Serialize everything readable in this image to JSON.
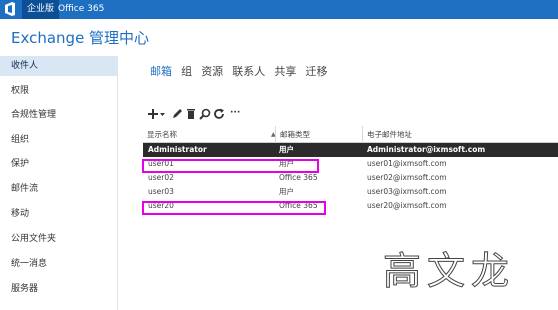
{
  "top_bar": {
    "tab_enterprise": "企业版",
    "tab_office365": "Office 365"
  },
  "app_title": "Exchange 管理中心",
  "sidebar": {
    "items": [
      {
        "label": "收件人",
        "active": true
      },
      {
        "label": "权限"
      },
      {
        "label": "合规性管理"
      },
      {
        "label": "组织"
      },
      {
        "label": "保护"
      },
      {
        "label": "邮件流"
      },
      {
        "label": "移动"
      },
      {
        "label": "公用文件夹"
      },
      {
        "label": "统一消息"
      },
      {
        "label": "服务器"
      }
    ]
  },
  "subnav": {
    "tabs": [
      {
        "label": "邮箱",
        "active": true
      },
      {
        "label": "组"
      },
      {
        "label": "资源"
      },
      {
        "label": "联系人"
      },
      {
        "label": "共享"
      },
      {
        "label": "迁移"
      }
    ]
  },
  "toolbar": {
    "icons": [
      "add-icon",
      "edit-icon",
      "delete-icon",
      "search-icon",
      "refresh-icon",
      "more-icon"
    ],
    "more_label": "···"
  },
  "grid": {
    "columns": [
      "显示名称",
      "邮箱类型",
      "电子邮件地址"
    ],
    "sort_indicator": "▲",
    "rows": [
      {
        "name": "Administrator",
        "type": "用户",
        "email": "Administrator@ixmsoft.com",
        "selected": true
      },
      {
        "name": "user01",
        "type": "用户",
        "email": "user01@ixmsoft.com"
      },
      {
        "name": "user02",
        "type": "Office 365",
        "email": "user02@ixmsoft.com"
      },
      {
        "name": "user03",
        "type": "用户",
        "email": "user03@ixmsoft.com"
      },
      {
        "name": "user20",
        "type": "Office 365",
        "email": "user20@ixmsoft.com"
      }
    ]
  },
  "watermark": "高文龙",
  "colors": {
    "brand_blue": "#1e6fc2",
    "selected_row": "#2b2b2b",
    "highlight_box": "#e600e6"
  }
}
